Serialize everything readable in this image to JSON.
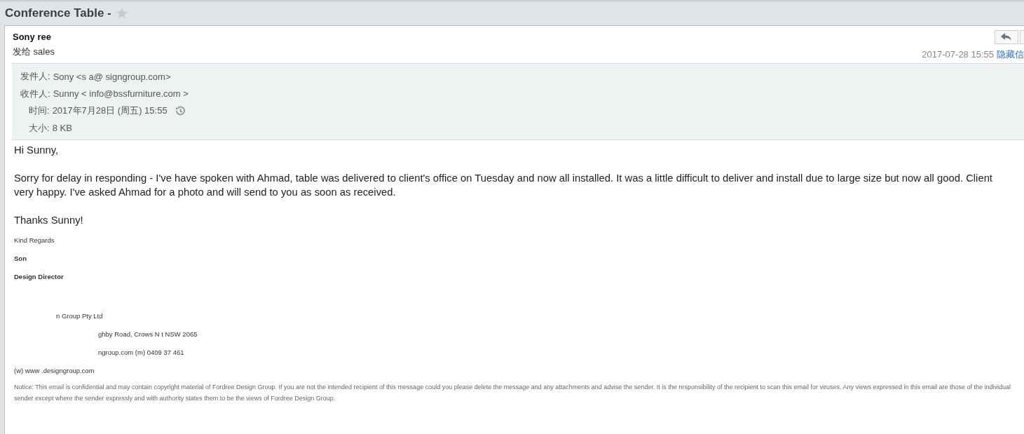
{
  "window": {
    "title": "Conference Table -",
    "starred": false
  },
  "header": {
    "sender": "Sony ree",
    "recipient_line": "发给 sales",
    "date": "2017-07-28 15:55",
    "hide_link": "隐藏信"
  },
  "details": [
    {
      "label": "发件人:",
      "value": "Sony  <s a@ signgroup.com>",
      "kind": "text"
    },
    {
      "label": "收件人:",
      "value": "Sunny < info@bssfurniture.com >",
      "kind": "text"
    },
    {
      "label": "时间:",
      "value": "2017年7月28日 (周五) 15:55",
      "kind": "time"
    },
    {
      "label": "大小:",
      "value": "8 KB",
      "kind": "text"
    }
  ],
  "body": {
    "paragraphs": [
      "Hi Sunny,",
      "Sorry for delay in responding - I've have spoken with Ahmad, table was delivered to client's office on Tuesday and now all installed.  It was a little difficult to deliver and install due to large size but now all good.  Client very happy.  I've asked Ahmad for a photo and will send to you as soon as received.",
      "Thanks Sunny!"
    ],
    "signature": [
      {
        "text": "Kind Regards",
        "kind": "plain"
      },
      {
        "text": "Son",
        "kind": "bold"
      },
      {
        "text": "Design Director",
        "kind": "bold"
      },
      {
        "text": "n Group Pty Ltd",
        "kind": "gap"
      },
      {
        "text": "ghby Road, Crows N  t NSW 2065",
        "kind": "widegap"
      },
      {
        "text": "ngroup.com  (m) 0409  37 461",
        "kind": "widegap"
      },
      {
        "text": "(w) www        .designgroup.com",
        "kind": "plain"
      }
    ],
    "notice": "Notice: This email is confidential and may contain copyright material of Fordree Design Group. If you are not the intended recipient of this message could you please delete the message and any attachments and advise the sender. It is the responsibility of the recipient to scan this email for viruses. Any views expressed in this email are those of the individual sender except where the sender expressly and with authority states them to be the views of Fordree Design Group."
  }
}
